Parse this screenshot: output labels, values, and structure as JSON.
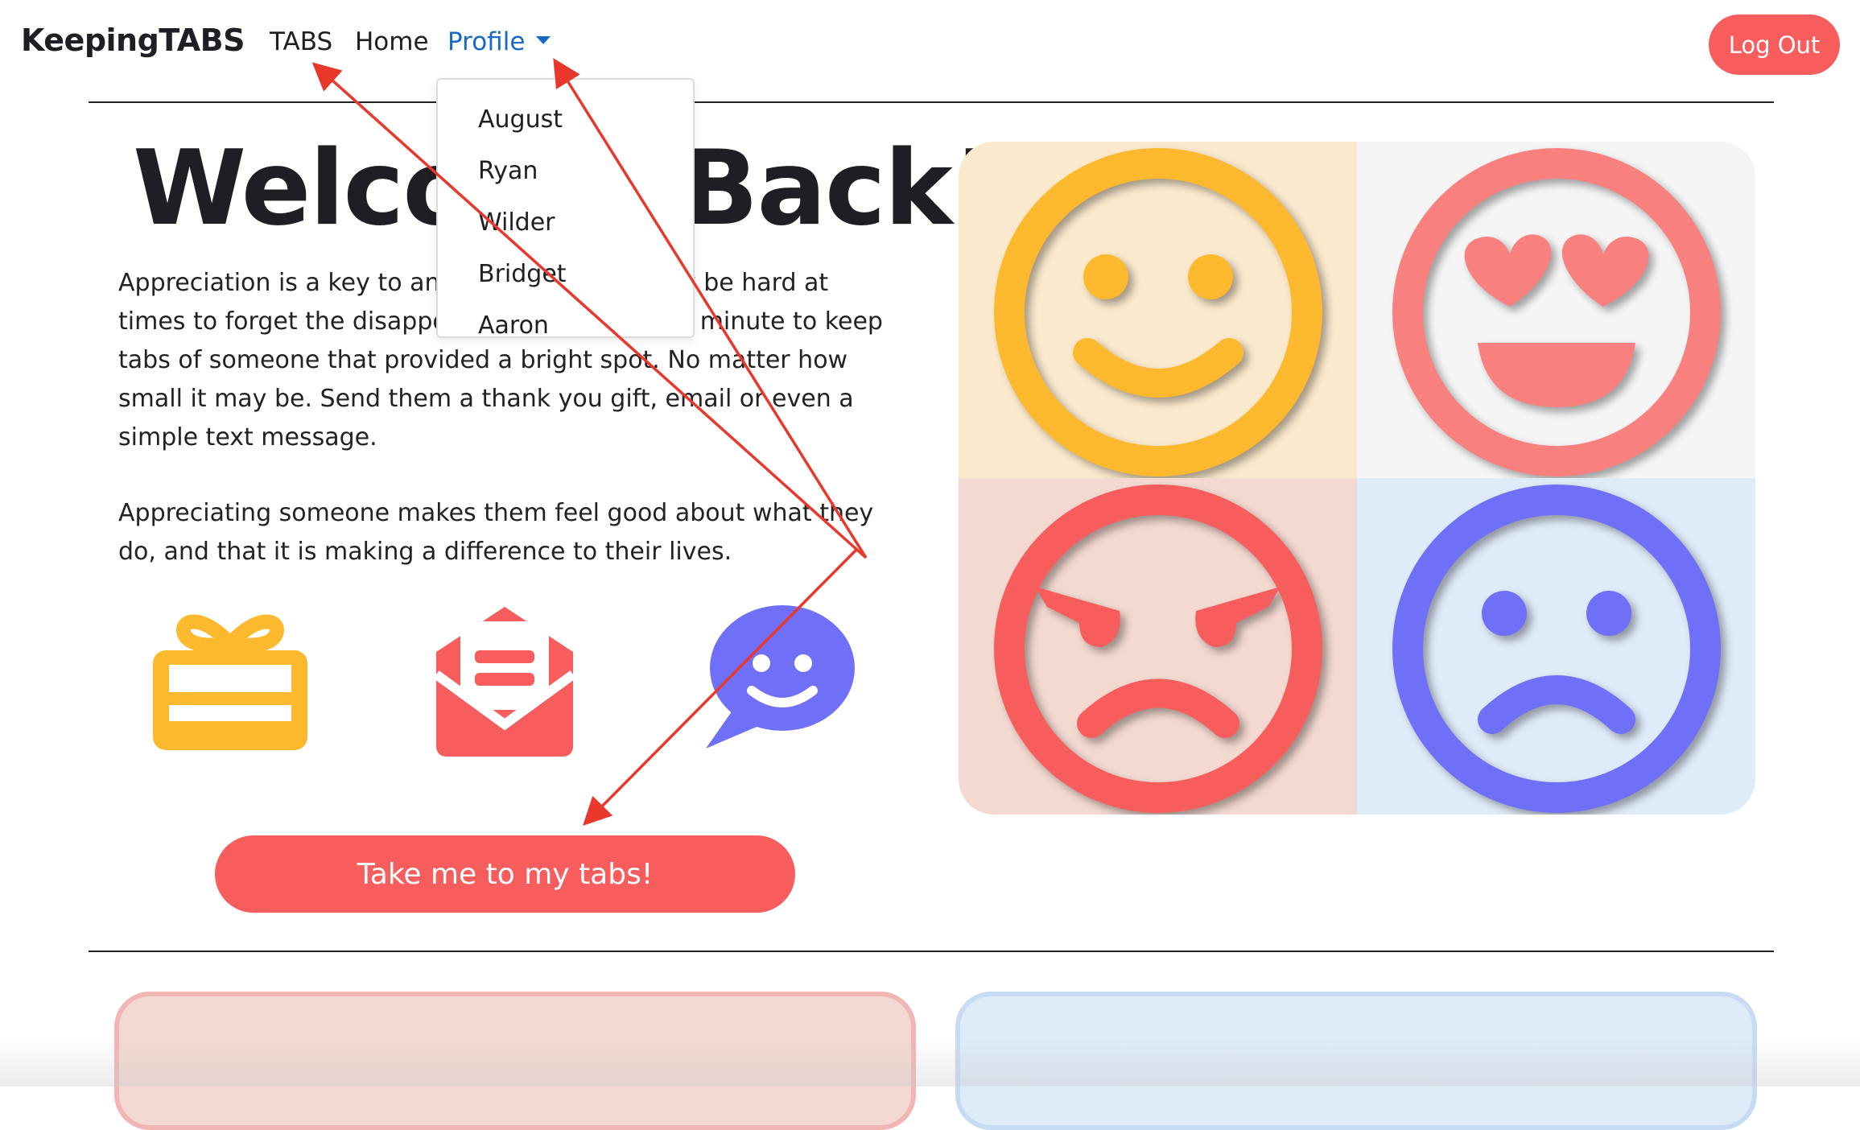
{
  "nav": {
    "brand": "KeepingTABS",
    "tabs": "TABS",
    "home": "Home",
    "profile": "Profile",
    "logout": "Log Out"
  },
  "dropdown": {
    "items": [
      "August",
      "Ryan",
      "Wilder",
      "Bridget",
      "Aaron"
    ]
  },
  "hero": {
    "title": "Welcome Back!",
    "paragraph_1": "Appreciation is a key to any relationship. It may be hard at times to forget the disappointments, but take a minute to keep tabs of someone that provided a bright spot. No matter how small it may be. Send them a thank you gift, email or even a simple text message.",
    "paragraph_2": "Appreciating someone makes them feel good about what they do, and that it is making a difference to their lives.",
    "cta": "Take me to my tabs!"
  },
  "icons": [
    "gift-icon",
    "email-icon",
    "chat-smile-icon"
  ],
  "faces": [
    "smiling-face-icon",
    "heart-eyes-face-icon",
    "angry-face-icon",
    "sad-face-icon"
  ],
  "colors": {
    "accent": "#f85d5e",
    "link_active": "#1668c9",
    "yellow": "#fdb92e",
    "pink": "#f88180",
    "red": "#f85d5e",
    "purple": "#6f6ff8",
    "annotation_arrow": "#e8382b"
  }
}
